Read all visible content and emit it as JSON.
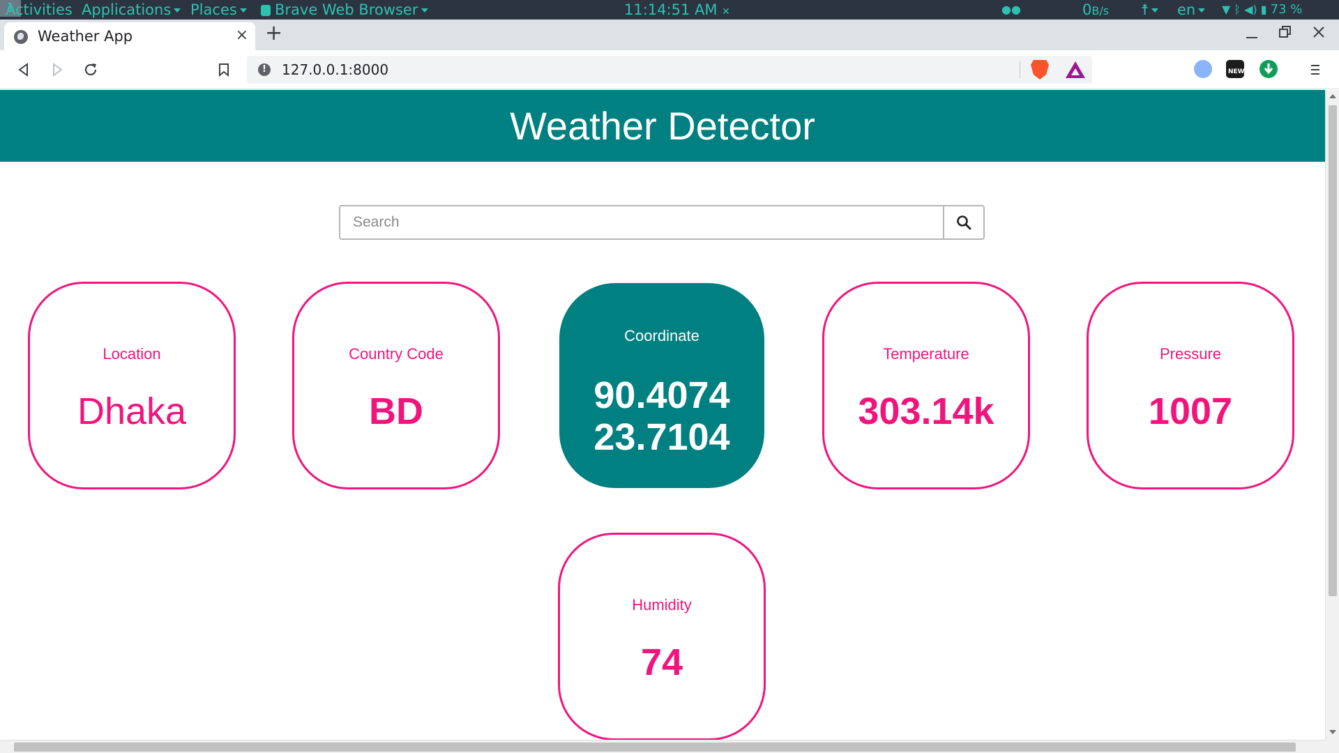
{
  "system_bar": {
    "activities": "Activities",
    "applications": "Applications",
    "places": "Places",
    "app_name": "Brave Web Browser",
    "clock": "11:14:51 AM",
    "workspace": "1",
    "net_speed": "0",
    "net_unit": "B/s",
    "language": "en",
    "battery": "73 %"
  },
  "browser": {
    "tab_title": "Weather App",
    "tab_close": "×",
    "new_tab": "+",
    "url": "127.0.0.1:8000"
  },
  "page": {
    "title": "Weather Detector",
    "search": {
      "placeholder": "Search",
      "value": ""
    },
    "cards": {
      "location": {
        "label": "Location",
        "value": "Dhaka"
      },
      "country": {
        "label": "Country Code",
        "value": "BD"
      },
      "coordinate": {
        "label": "Coordinate",
        "lon": "90.4074",
        "lat": "23.7104"
      },
      "temperature": {
        "label": "Temperature",
        "value": "303.14k"
      },
      "pressure": {
        "label": "Pressure",
        "value": "1007"
      },
      "humidity": {
        "label": "Humidity",
        "value": "74"
      }
    }
  },
  "colors": {
    "accent": "#008080",
    "card_border": "#f0147c",
    "topbar_bg": "#2b3440",
    "topbar_text": "#2fc1b0"
  }
}
